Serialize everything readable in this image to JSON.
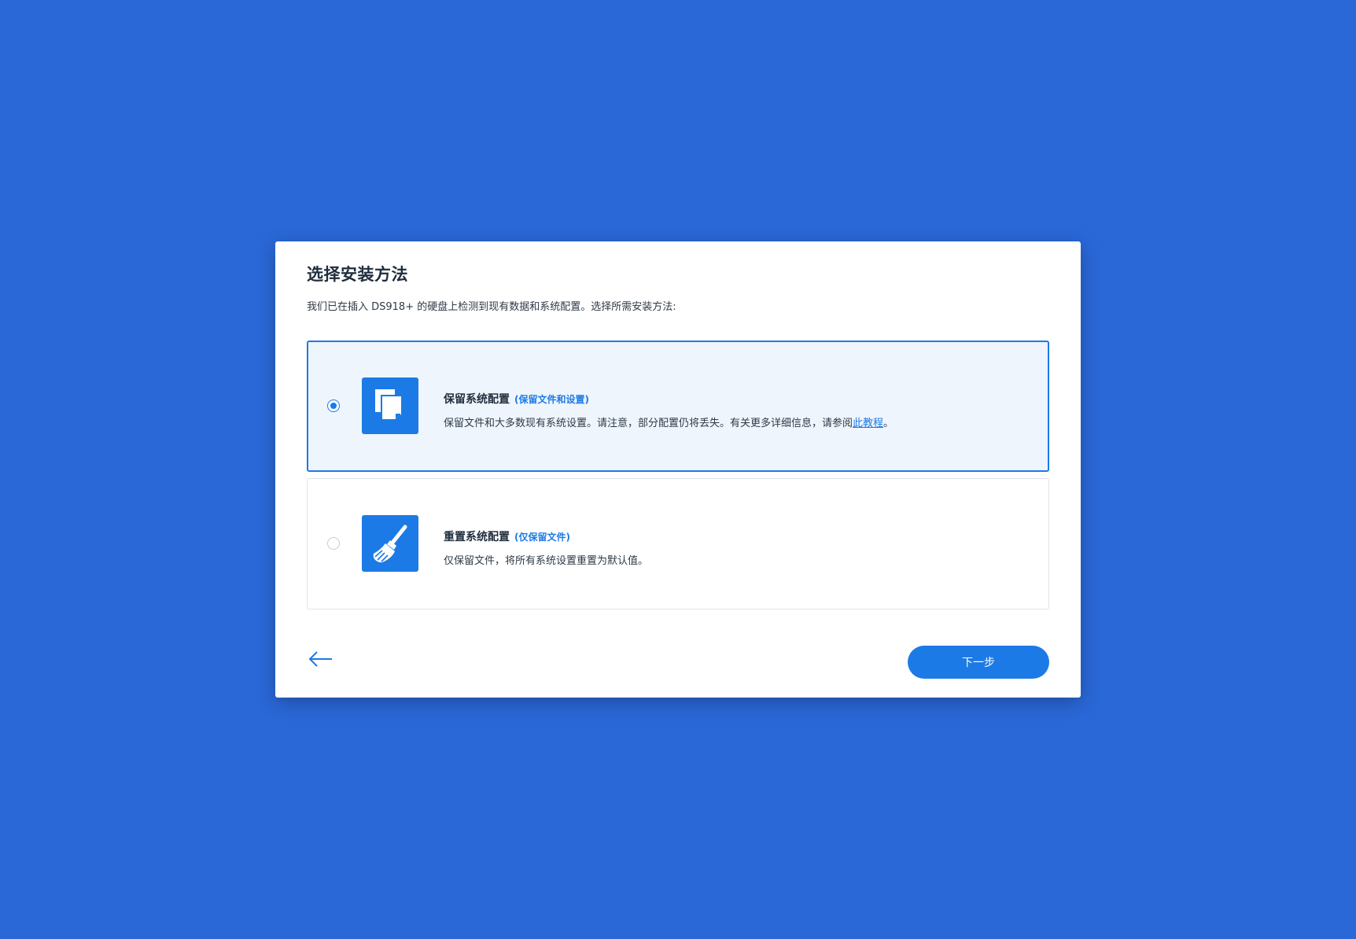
{
  "dialog": {
    "title": "选择安装方法",
    "subtitle": "我们已在插入 DS918+ 的硬盘上检测到现有数据和系统配置。选择所需安装方法:"
  },
  "options": [
    {
      "title": "保留系统配置",
      "tag": "(保留文件和设置)",
      "description_before_link": "保留文件和大多数现有系统设置。请注意，部分配置仍将丢失。有关更多详细信息，请参阅",
      "link_text": "此教程",
      "description_after_link": "。",
      "icon": "copy-files-icon",
      "selected": true
    },
    {
      "title": "重置系统配置",
      "tag": "(仅保留文件)",
      "description": "仅保留文件，将所有系统设置重置为默认值。",
      "icon": "broom-icon",
      "selected": false
    }
  ],
  "footer": {
    "back_icon": "arrow-left-icon",
    "next_label": "下一步"
  },
  "colors": {
    "background": "#2a68d8",
    "accent": "#1c7ae6",
    "selected_bg": "#eff5fc"
  }
}
